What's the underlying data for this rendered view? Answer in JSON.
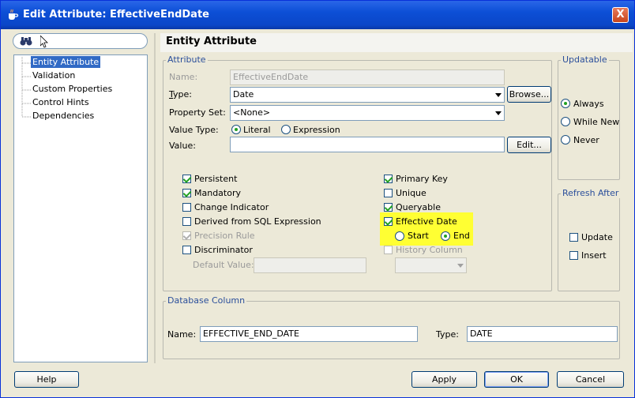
{
  "window": {
    "title": "Edit Attribute: EffectiveEndDate",
    "close_glyph": "X"
  },
  "left": {
    "search_placeholder": "",
    "tree": [
      "Entity Attribute",
      "Validation",
      "Custom Properties",
      "Control Hints",
      "Dependencies"
    ],
    "selected_index": 0
  },
  "header": {
    "title": "Entity Attribute"
  },
  "attribute": {
    "legend": "Attribute",
    "name_label": "Name:",
    "name_value": "EffectiveEndDate",
    "type_label": "Type:",
    "type_value": "Date",
    "browse_label": "Browse...",
    "property_set_label": "Property Set:",
    "property_set_value": "<None>",
    "value_type_label": "Value Type:",
    "value_type_literal": "Literal",
    "value_type_expression": "Expression",
    "value_label": "Value:",
    "value_value": "",
    "edit_label": "Edit...",
    "persistent": "Persistent",
    "mandatory": "Mandatory",
    "change_indicator": "Change Indicator",
    "derived": "Derived from SQL Expression",
    "precision_rule": "Precision Rule",
    "discriminator": "Discriminator",
    "default_value_label": "Default Value:",
    "primary_key": "Primary Key",
    "unique": "Unique",
    "queryable": "Queryable",
    "effective_date": "Effective Date",
    "start": "Start",
    "end": "End",
    "history_column": "History Column"
  },
  "updatable": {
    "legend": "Updatable",
    "always": "Always",
    "while_new": "While New",
    "never": "Never"
  },
  "refresh_after": {
    "legend": "Refresh After",
    "update": "Update",
    "insert": "Insert"
  },
  "database_column": {
    "legend": "Database Column",
    "name_label": "Name:",
    "name_value": "EFFECTIVE_END_DATE",
    "type_label": "Type:",
    "type_value": "DATE"
  },
  "footer": {
    "help": "Help",
    "apply": "Apply",
    "ok": "OK",
    "cancel": "Cancel"
  },
  "colors": {
    "titlebar": "#0c4fd6",
    "highlight": "#ffff33",
    "selection": "#316ac5"
  },
  "icons": {
    "app": "coffee-cup-icon",
    "search": "binoculars-icon"
  }
}
